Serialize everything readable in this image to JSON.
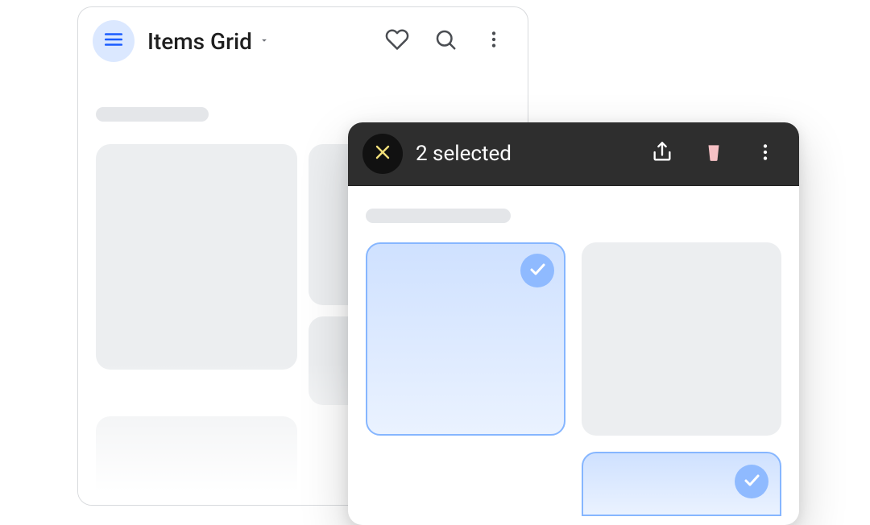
{
  "backWindow": {
    "title": "Items Grid",
    "items": [
      {
        "selected": false
      },
      {
        "selected": false
      },
      {
        "selected": false
      },
      {
        "selected": false
      }
    ]
  },
  "selectionOverlay": {
    "statusText": "2 selected",
    "selectedCount": 2,
    "items": [
      {
        "selected": true
      },
      {
        "selected": false
      },
      {
        "selected": false
      },
      {
        "selected": true
      }
    ]
  },
  "icons": {
    "menu": "menu",
    "dropdown": "chevron-down",
    "favorite": "heart",
    "search": "search",
    "more": "more-vertical",
    "close": "close",
    "share": "share",
    "delete": "trash",
    "check": "check"
  },
  "colors": {
    "menuBg": "#dbe8ff",
    "menuIcon": "#1a5cff",
    "selectionBarBg": "#2e2e2e",
    "closeBg": "#111111",
    "closeX": "#f2e07a",
    "trash": "#f6c0c4",
    "selectedCardBg": "#cfe1ff",
    "selectedCardBorder": "#86b6ff",
    "checkBadge": "#8fbaff"
  }
}
